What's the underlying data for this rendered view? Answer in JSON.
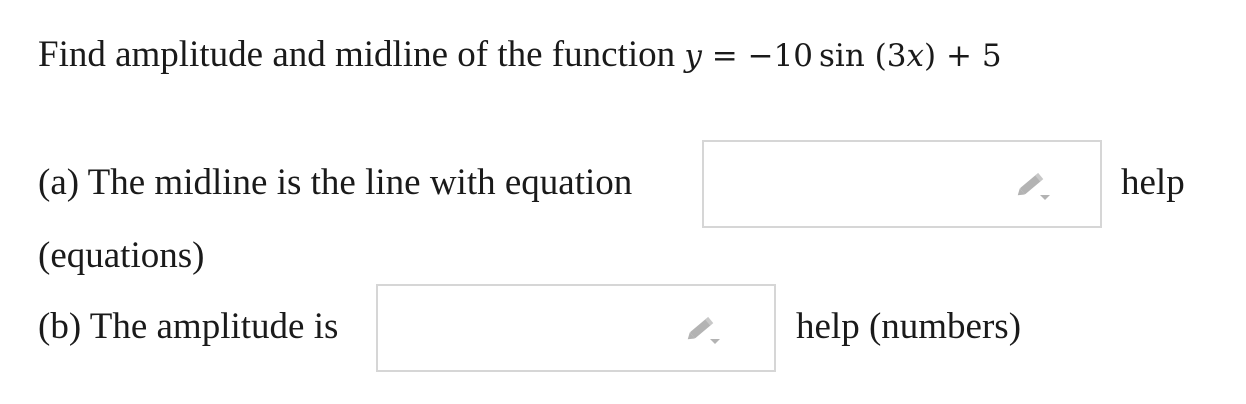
{
  "question": {
    "prefix": "Find amplitude and midline of the function",
    "math": {
      "lhs_var": "y",
      "equals": "=",
      "coefficient": "−10",
      "func": "sin",
      "open_paren": "(",
      "inner_coef": "3",
      "inner_var": "x",
      "close_paren": ")",
      "plus": "+",
      "constant": "5"
    }
  },
  "part_a": {
    "label": "(a) The midline is the line with equation",
    "input_value": "",
    "help_link": "help",
    "help_type": "(equations)"
  },
  "part_b": {
    "label": "(b) The amplitude is",
    "input_value": "",
    "help_link": "help",
    "help_type": "(numbers)"
  },
  "icons": {
    "input_icon": "pencil-dropdown-icon"
  },
  "colors": {
    "box_border": "#d6d6d6",
    "icon_gray": "#b3b3b3",
    "text": "#1a1a1a"
  }
}
